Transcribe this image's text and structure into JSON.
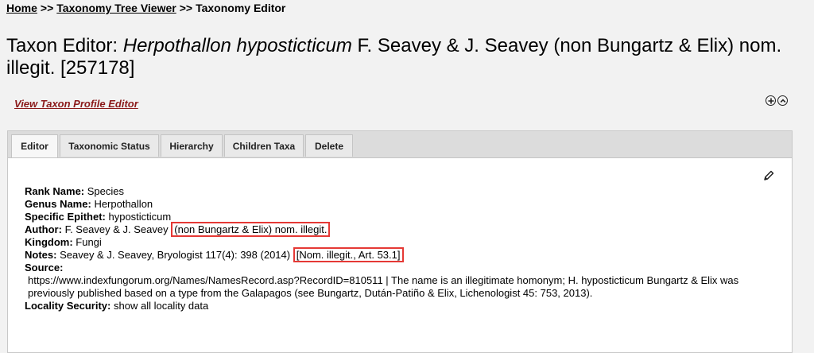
{
  "breadcrumb": {
    "home": "Home",
    "sep1": ">>",
    "tree_viewer": "Taxonomy Tree Viewer",
    "sep2": ">>",
    "current": "Taxonomy Editor"
  },
  "title": {
    "prefix": "Taxon Editor: ",
    "sciname": "Herpothallon hyposticticum",
    "rest": " F. Seavey & J. Seavey (non Bungartz & Elix) nom. illegit. [257178]"
  },
  "profile_link": "View Taxon Profile Editor",
  "tabs": [
    {
      "label": "Editor"
    },
    {
      "label": "Taxonomic Status"
    },
    {
      "label": "Hierarchy"
    },
    {
      "label": "Children Taxa"
    },
    {
      "label": "Delete"
    }
  ],
  "fields": {
    "rank_label": "Rank Name:",
    "rank_value": "Species",
    "genus_label": "Genus Name:",
    "genus_value": "Herpothallon",
    "epithet_label": "Specific Epithet:",
    "epithet_value": "hyposticticum",
    "author_label": "Author:",
    "author_value": "F. Seavey & J. Seavey",
    "author_highlight": "(non Bungartz & Elix) nom. illegit.",
    "kingdom_label": "Kingdom:",
    "kingdom_value": "Fungi",
    "notes_label": "Notes:",
    "notes_value": "Seavey & J. Seavey, Bryologist 117(4): 398 (2014)",
    "notes_highlight": "[Nom. illegit., Art. 53.1]",
    "source_label": "Source:",
    "source_value": "https://www.indexfungorum.org/Names/NamesRecord.asp?RecordID=810511 | The name is an illegitimate homonym; H. hyposticticum Bungartz & Elix was previously published based on a type from the Galapagos (see Bungartz, Dután-Patiño & Elix, Lichenologist 45: 753, 2013).",
    "security_label": "Locality Security:",
    "security_value": "show all locality data"
  },
  "icons": {
    "expand": "plus-circle-icon",
    "collapse": "chevron-up-circle-icon",
    "edit": "pencil-icon"
  },
  "colors": {
    "link": "#8b1a1a",
    "highlight_box": "#e53935"
  }
}
